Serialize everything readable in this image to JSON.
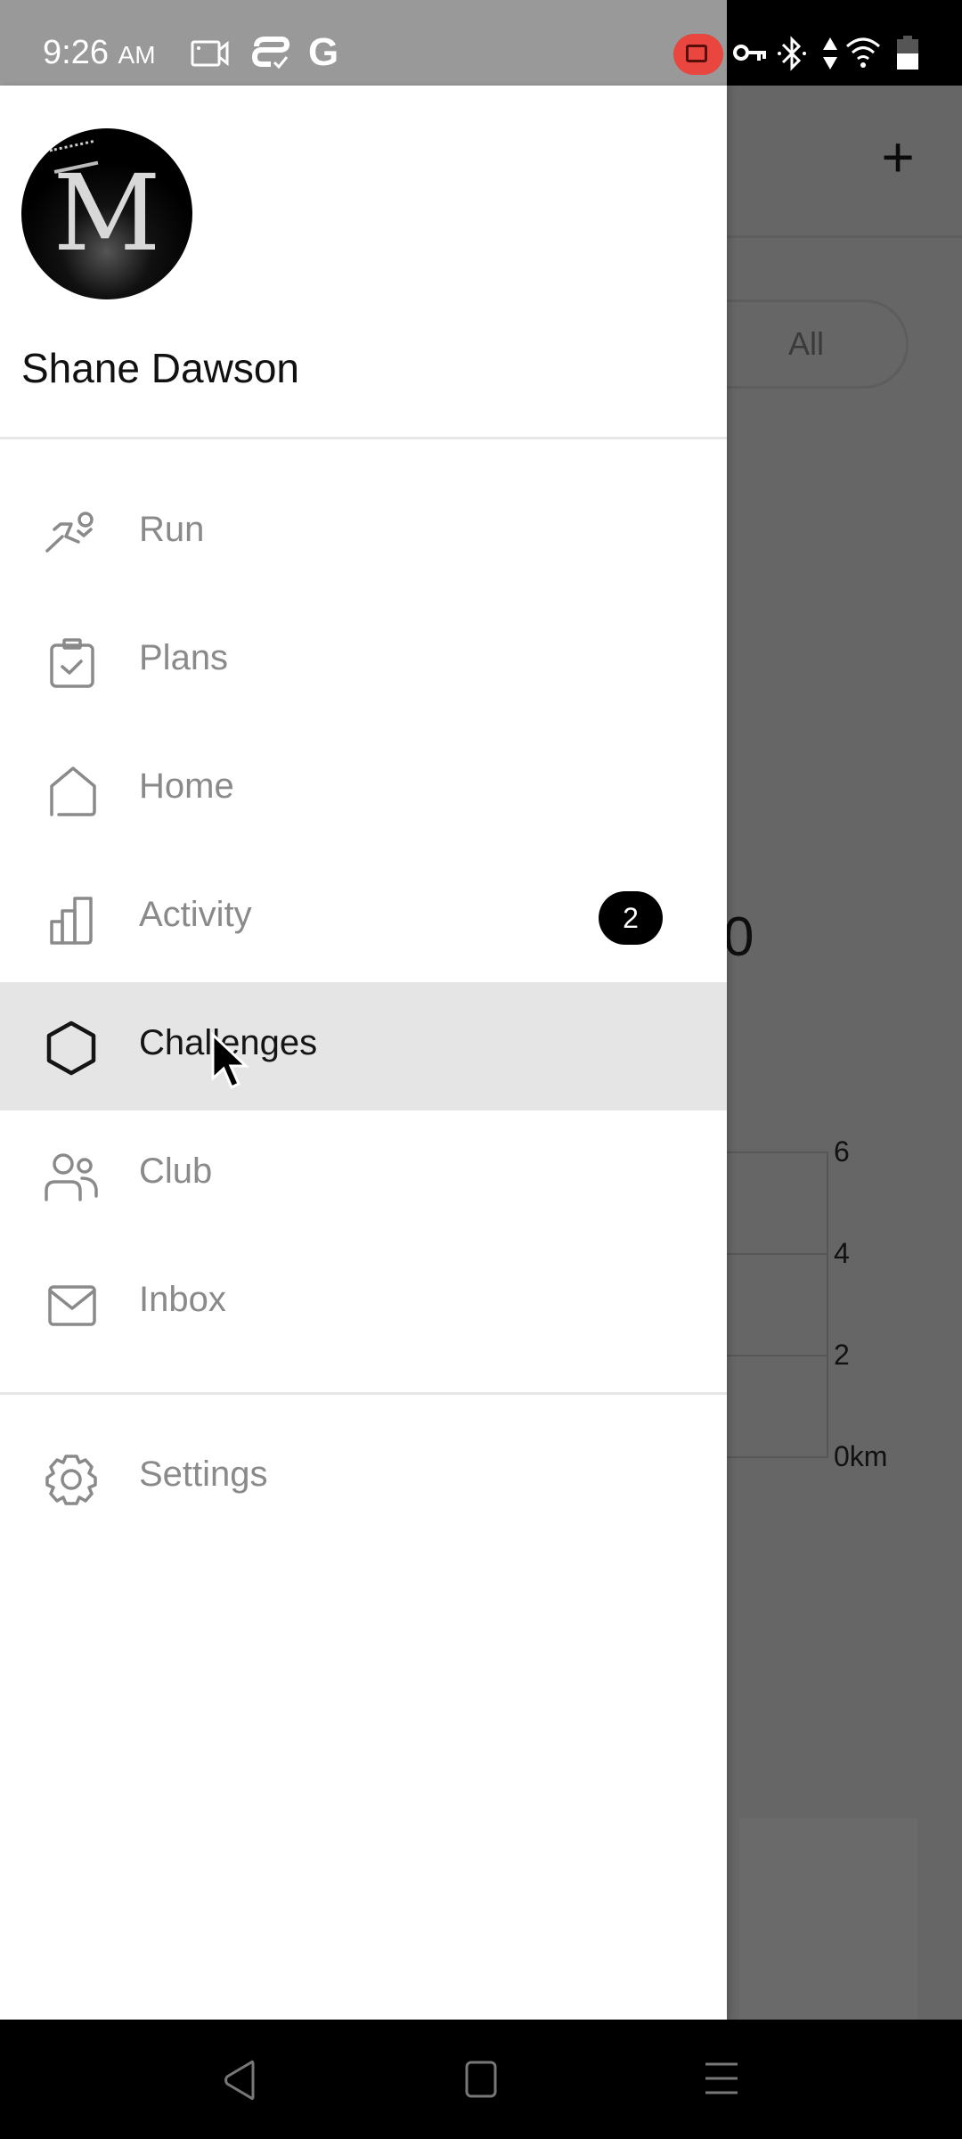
{
  "status_bar": {
    "time": "9:26",
    "ampm": "AM",
    "icons": [
      "screen-record-icon",
      "sync-icon",
      "google-icon",
      "recording-active-icon",
      "vpn-key-icon",
      "bluetooth-icon",
      "data-arrows-icon",
      "wifi-icon",
      "battery-icon"
    ],
    "recording_color": "#e8463f"
  },
  "drawer": {
    "user_name": "Shane Dawson",
    "avatar_letter": "M",
    "items": [
      {
        "label": "Run",
        "icon": "runner-icon"
      },
      {
        "label": "Plans",
        "icon": "clipboard-check-icon"
      },
      {
        "label": "Home",
        "icon": "home-icon"
      },
      {
        "label": "Activity",
        "icon": "bar-chart-icon",
        "badge": "2"
      },
      {
        "label": "Challenges",
        "icon": "hexagon-icon",
        "active": true
      },
      {
        "label": "Club",
        "icon": "people-icon"
      },
      {
        "label": "Inbox",
        "icon": "envelope-icon"
      }
    ],
    "settings": {
      "label": "Settings",
      "icon": "gear-icon"
    },
    "active_bg": "#e5e5e5"
  },
  "background_app": {
    "add_button": "+",
    "filter_pill": "All",
    "big_value_partial": "0",
    "chart_ticks": [
      "6",
      "4",
      "2",
      "0km"
    ]
  },
  "nav_bar": {
    "buttons": [
      "back",
      "home",
      "recents"
    ]
  }
}
